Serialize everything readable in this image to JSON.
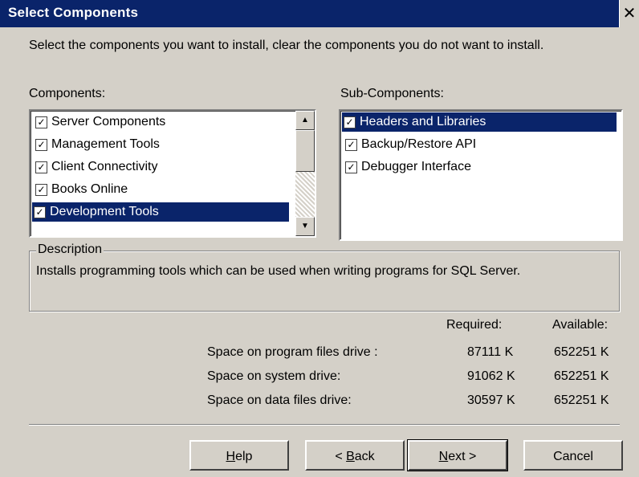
{
  "window": {
    "title": "Select Components",
    "close_glyph": "✕"
  },
  "instructions": "Select the components you want to install, clear the components you do not want to install.",
  "components": {
    "label": "Components:",
    "items": [
      {
        "label": "Server Components",
        "checked": true,
        "selected": false
      },
      {
        "label": "Management Tools",
        "checked": true,
        "selected": false
      },
      {
        "label": "Client Connectivity",
        "checked": true,
        "selected": false
      },
      {
        "label": "Books Online",
        "checked": true,
        "selected": false
      },
      {
        "label": "Development Tools",
        "checked": true,
        "selected": true
      }
    ]
  },
  "sub_components": {
    "label": "Sub-Components:",
    "items": [
      {
        "label": "Headers and Libraries",
        "checked": true,
        "selected": true
      },
      {
        "label": "Backup/Restore API",
        "checked": true,
        "selected": false
      },
      {
        "label": "Debugger Interface",
        "checked": true,
        "selected": false
      }
    ]
  },
  "description": {
    "legend": "Description",
    "text": "Installs programming tools which can be used when writing programs for SQL Server."
  },
  "space": {
    "header_required": "Required:",
    "header_available": "Available:",
    "rows": [
      {
        "label": "Space on program files drive :",
        "required": "87111 K",
        "available": "652251 K"
      },
      {
        "label": "Space on system drive:",
        "required": "91062 K",
        "available": "652251 K"
      },
      {
        "label": "Space on data files drive:",
        "required": "30597 K",
        "available": "652251 K"
      }
    ]
  },
  "buttons": {
    "help": {
      "pre": "",
      "mnemonic": "H",
      "post": "elp"
    },
    "back": {
      "pre": "< ",
      "mnemonic": "B",
      "post": "ack"
    },
    "next": {
      "pre": "",
      "mnemonic": "N",
      "post": "ext >"
    },
    "cancel": "Cancel"
  },
  "colors": {
    "titlebar": "#0a246a",
    "face": "#d4d0c8",
    "selection": "#0a246a"
  }
}
